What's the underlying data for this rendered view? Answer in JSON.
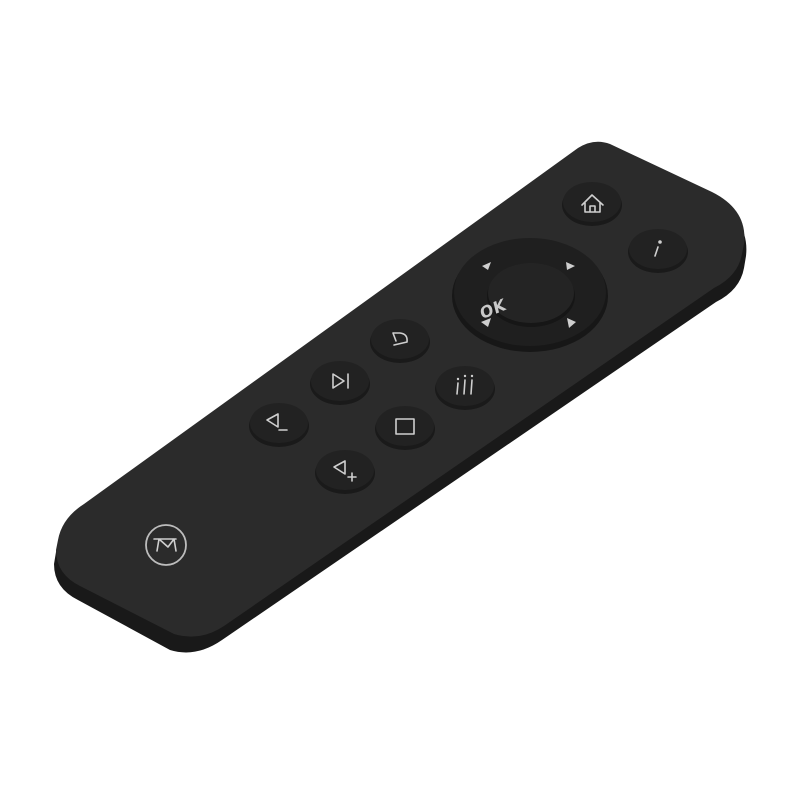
{
  "product": "Remote control",
  "colors": {
    "background": "#ffffff",
    "body_top": "#2b2b2b",
    "body_side": "#1b1b1b",
    "button": "#1f1f1f",
    "ring": "#1c1c1c",
    "glyph": "#cfcfcf"
  },
  "buttons": [
    {
      "name": "home",
      "icon": "home-icon",
      "label": ""
    },
    {
      "name": "info",
      "icon": "info-icon",
      "label": ""
    },
    {
      "name": "ok",
      "icon": "",
      "label": "OK"
    },
    {
      "name": "dpad-up",
      "icon": "arrow-up-icon",
      "label": ""
    },
    {
      "name": "dpad-right",
      "icon": "arrow-right-icon",
      "label": ""
    },
    {
      "name": "dpad-down",
      "icon": "arrow-down-icon",
      "label": ""
    },
    {
      "name": "dpad-left",
      "icon": "arrow-left-icon",
      "label": ""
    },
    {
      "name": "back",
      "icon": "back-icon",
      "label": ""
    },
    {
      "name": "play-pause",
      "icon": "play-pause-icon",
      "label": ""
    },
    {
      "name": "menu",
      "icon": "menu-icon",
      "label": ""
    },
    {
      "name": "volume-down",
      "icon": "volume-down-icon",
      "label": ""
    },
    {
      "name": "stop",
      "icon": "stop-icon",
      "label": ""
    },
    {
      "name": "volume-up",
      "icon": "volume-up-icon",
      "label": ""
    }
  ],
  "logo": {
    "icon": "brand-logo-icon"
  }
}
